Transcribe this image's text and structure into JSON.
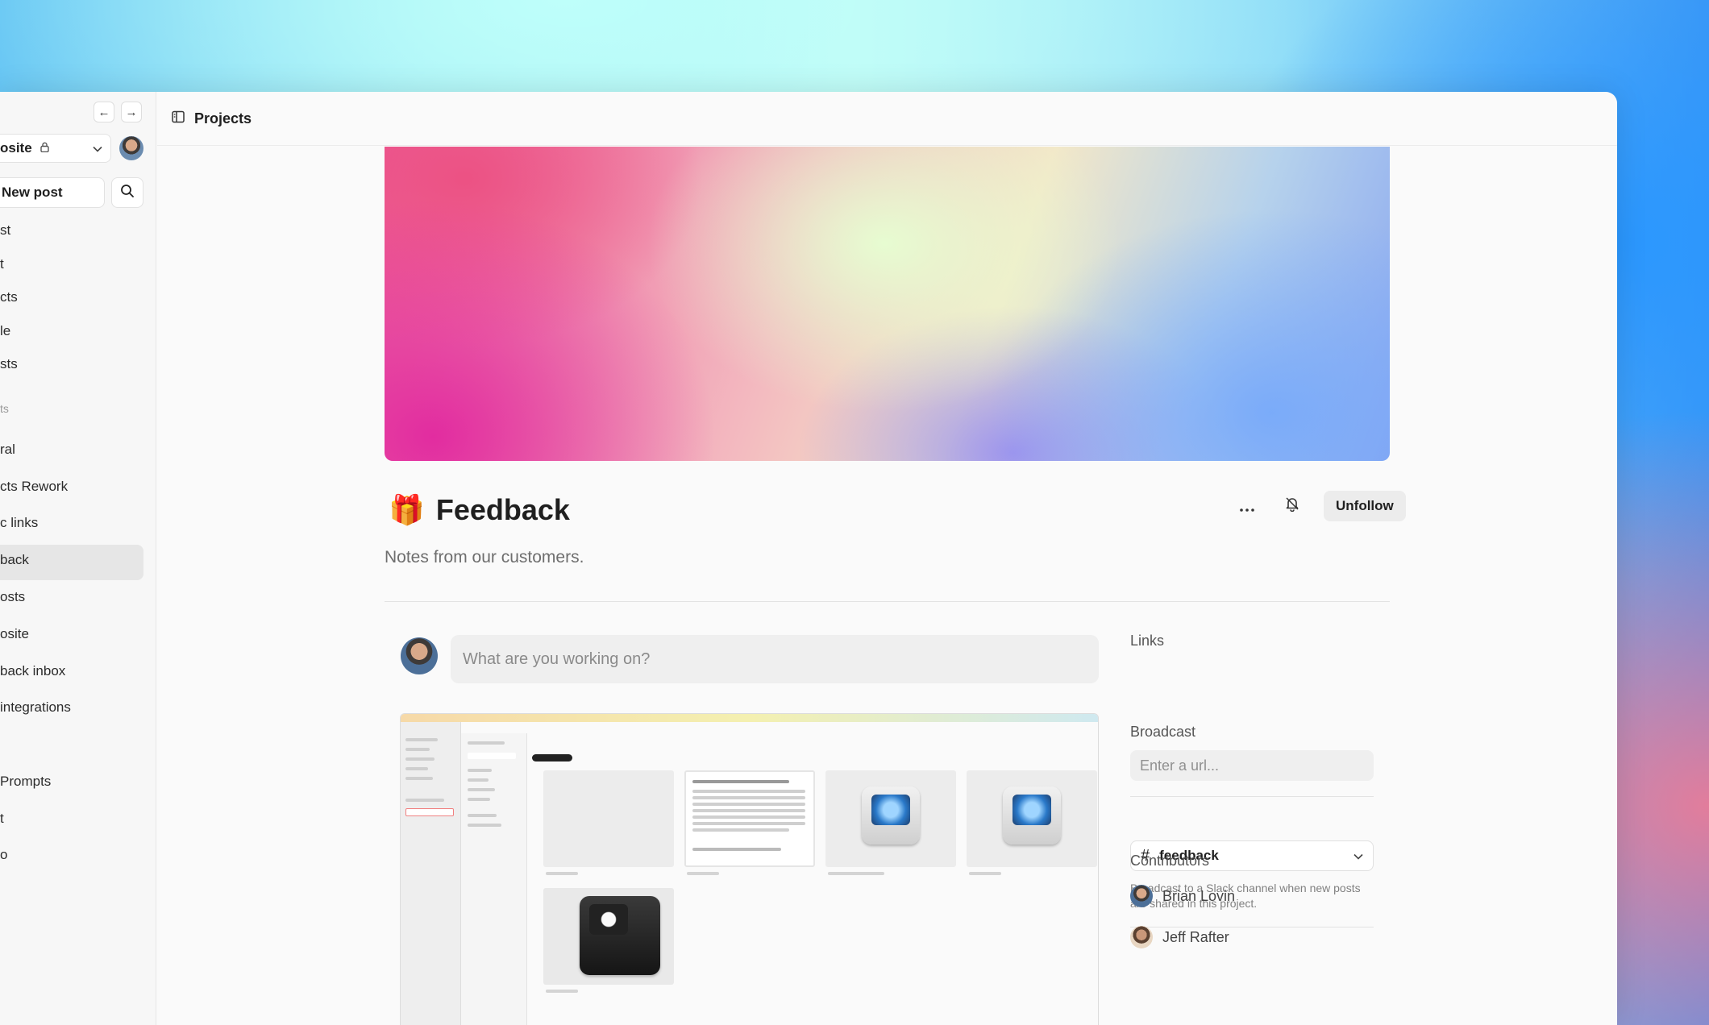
{
  "sidebar": {
    "workspace": "osite",
    "new_post": "New post",
    "items": [
      {
        "label": "st"
      },
      {
        "label": "t"
      },
      {
        "label": "cts"
      },
      {
        "label": "le"
      },
      {
        "label": "sts"
      }
    ],
    "section": "ts",
    "projects": [
      {
        "label": "ral"
      },
      {
        "label": "cts Rework"
      },
      {
        "label": "c links"
      },
      {
        "label": "back"
      },
      {
        "label": "osts"
      },
      {
        "label": "osite"
      },
      {
        "label": "back inbox"
      },
      {
        "label": "integrations"
      }
    ],
    "extra": [
      {
        "label": "Prompts"
      },
      {
        "label": "t"
      },
      {
        "label": "o"
      }
    ]
  },
  "header": {
    "title": "Projects"
  },
  "project": {
    "emoji": "🎁",
    "title": "Feedback",
    "description": "Notes from our customers.",
    "unfollow_label": "Unfollow"
  },
  "composer": {
    "placeholder": "What are you working on?"
  },
  "links": {
    "label": "Links",
    "placeholder": "Enter a url..."
  },
  "broadcast": {
    "label": "Broadcast",
    "channel": "feedback",
    "help": "Broadcast to a Slack channel when new posts are shared in this project."
  },
  "contributors": {
    "label": "Contributors",
    "people": [
      {
        "name": "Brian Lovin"
      },
      {
        "name": "Jeff Rafter"
      }
    ]
  },
  "icons": {
    "back": "arrow-left-icon",
    "forward": "arrow-right-icon",
    "lock": "lock-icon",
    "chevron": "chevron-down-icon",
    "search": "search-icon",
    "sidebar_toggle": "sidebar-toggle-icon",
    "more": "ellipsis-icon",
    "bell": "bell-icon",
    "hash": "hash-icon"
  }
}
